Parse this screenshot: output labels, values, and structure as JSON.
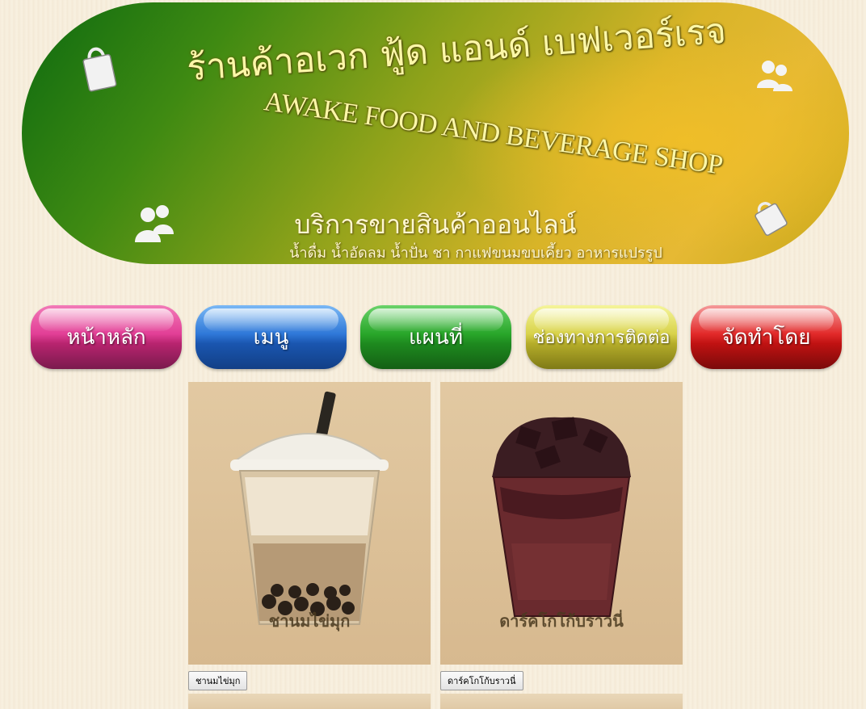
{
  "banner": {
    "title_th": "ร้านค้าอเวก ฟู้ด แอนด์ เบฟเวอร์เรจ",
    "title_en": "AWAKE FOOD AND BEVERAGE SHOP",
    "service_title": "บริการขายสินค้าออนไลน์",
    "service_sub": "น้ำดื่ม น้ำอัดลม น้ำปั่น ชา กาแฟขนมขบเคี้ยว อาหารแปรรูป",
    "icons": [
      "shopping-bag-icon",
      "users-icon",
      "users-icon",
      "shopping-bag-icon"
    ]
  },
  "nav": [
    {
      "label": "หน้าหลัก",
      "color": "#e23f96"
    },
    {
      "label": "เมนู",
      "color": "#2f78d8"
    },
    {
      "label": "แผนที่",
      "color": "#29a62a"
    },
    {
      "label": "ช่องทางการติดต่อ",
      "color": "#d8d24a"
    },
    {
      "label": "จัดทำโดย",
      "color": "#e22a2a"
    }
  ],
  "products": [
    {
      "caption": "ชานมไข่มุก",
      "button": "ชานมไข่มุก"
    },
    {
      "caption": "ดาร์คโกโก้บราวนี่",
      "button": "ดาร์คโกโก้บราวนี่"
    }
  ]
}
